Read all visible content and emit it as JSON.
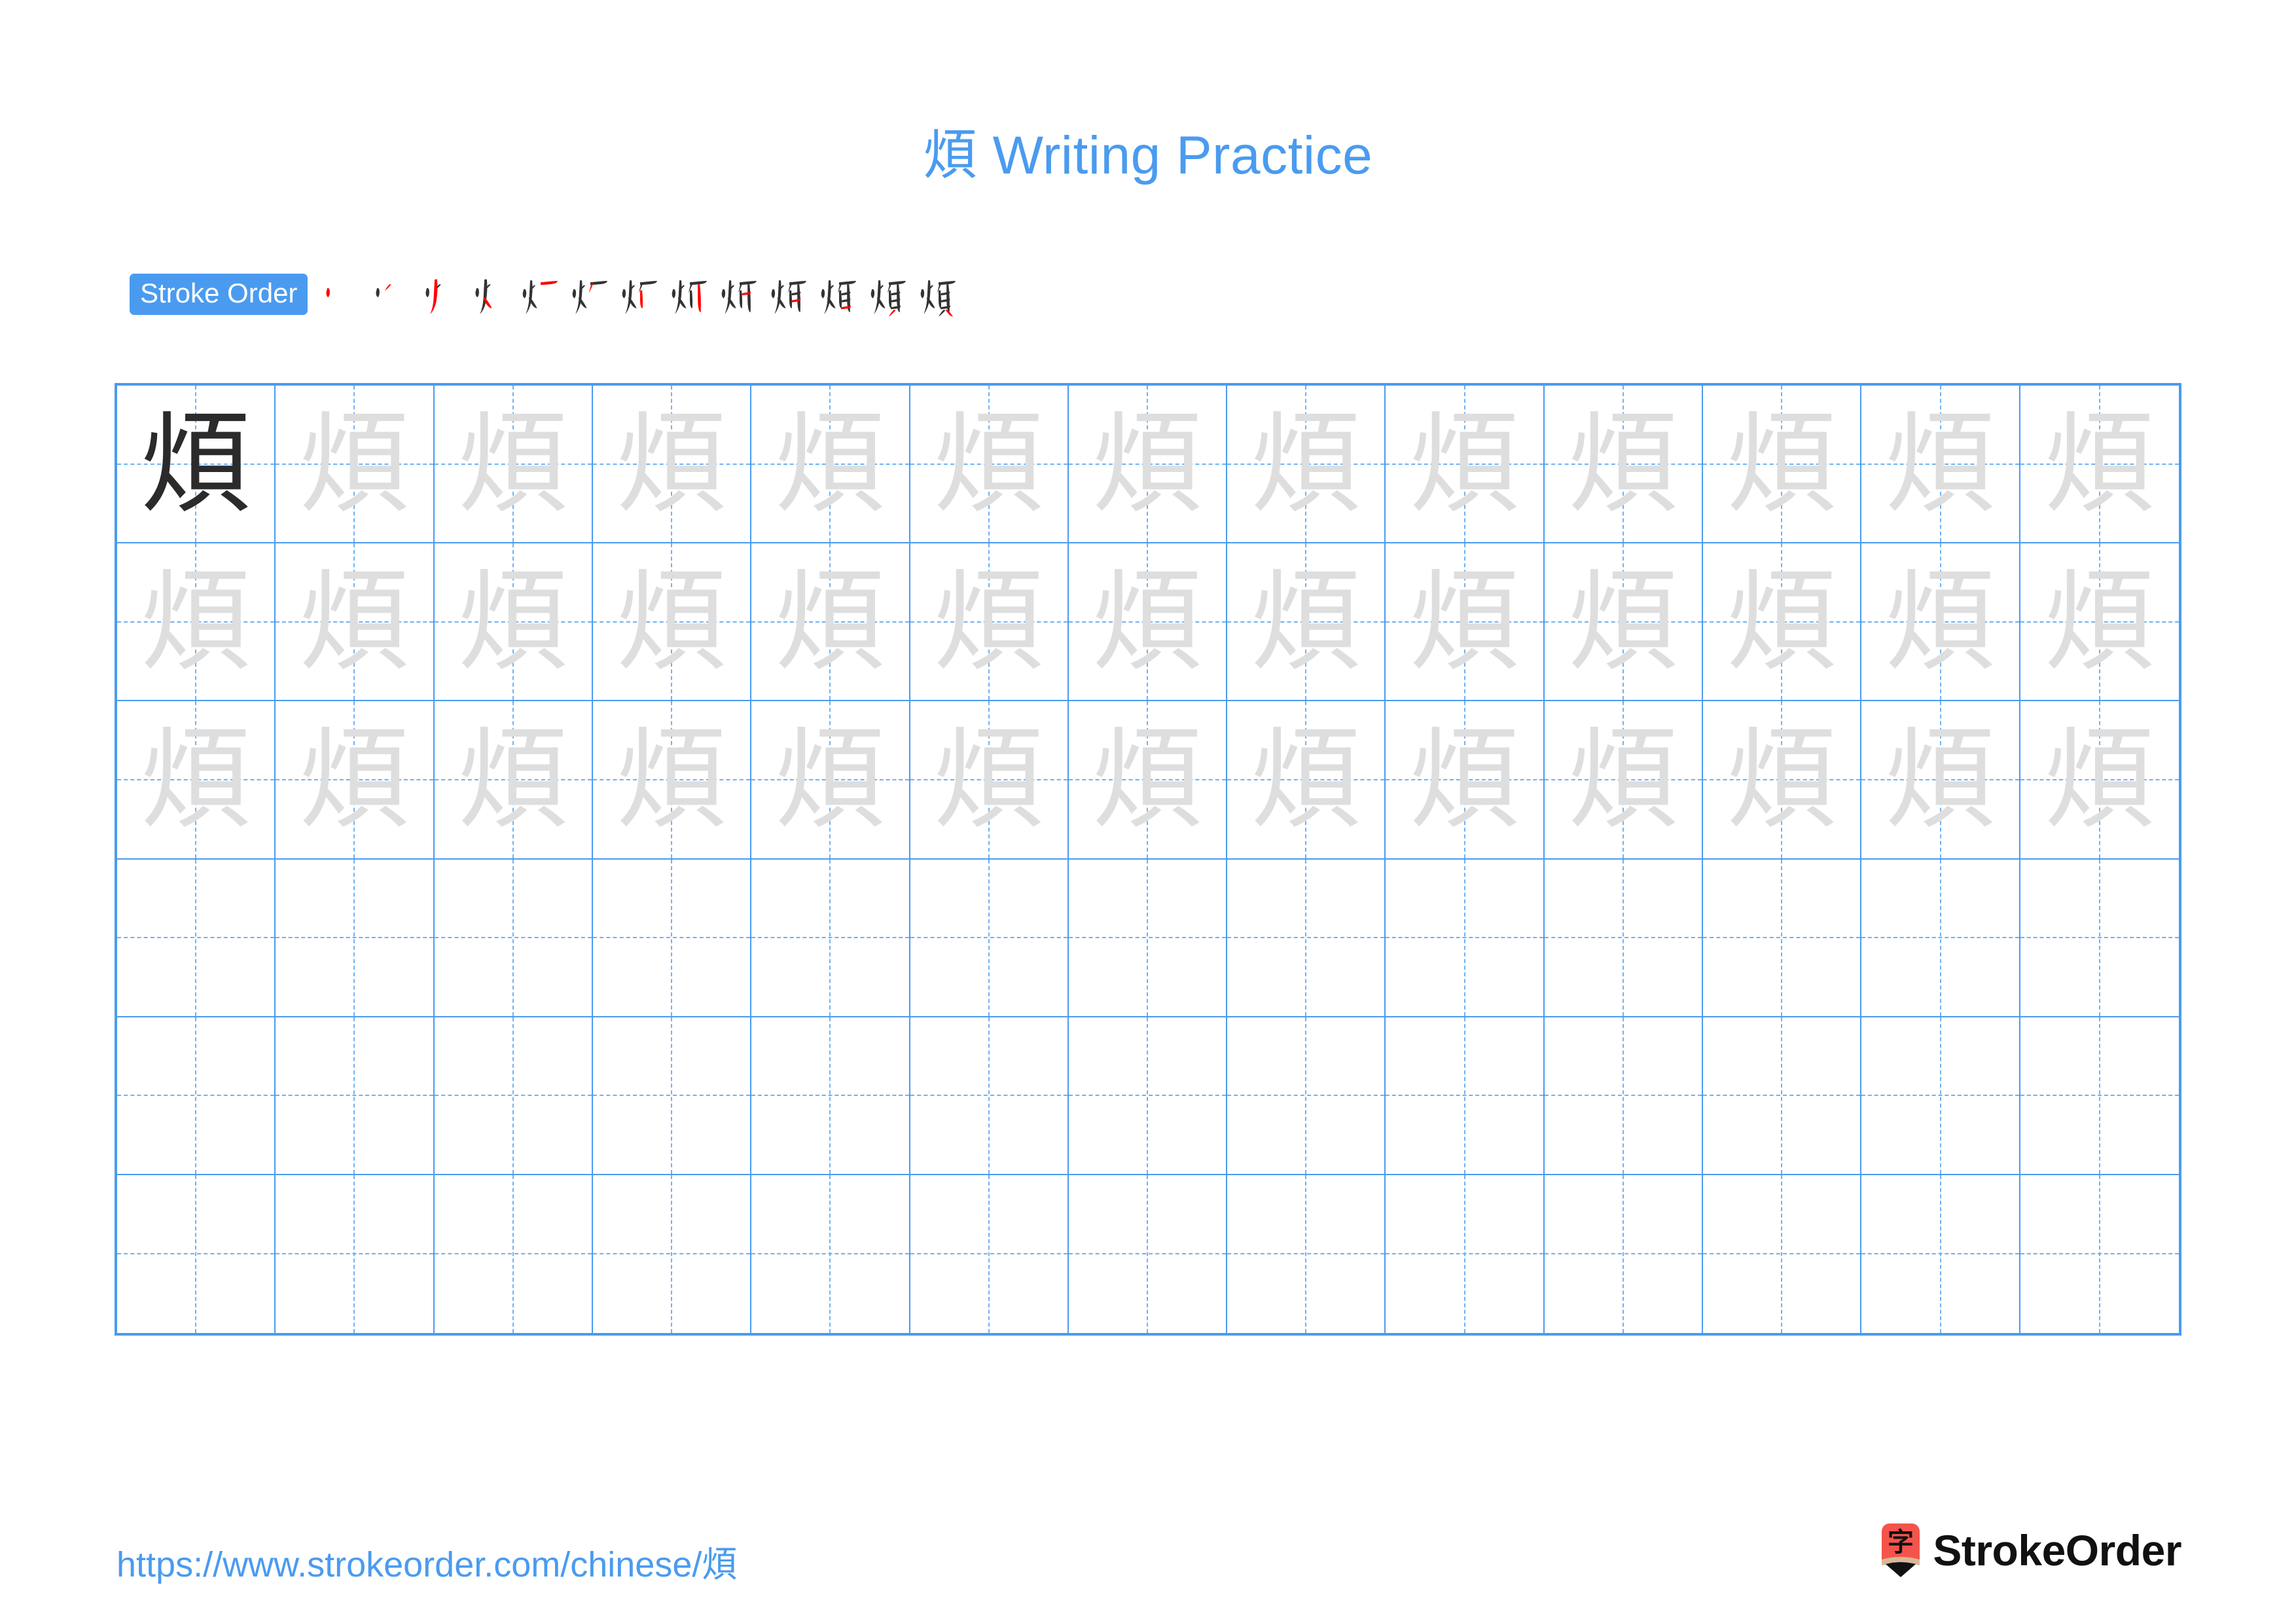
{
  "character": "煩",
  "colors": {
    "accent_blue": "#4a9bf0",
    "grid_line_blue": "#4a9bf0",
    "grid_dash_blue": "#6fb2f4",
    "solid_char": "#2b2b2b",
    "trace_char": "#dedede",
    "stroke_new": "#ff0000",
    "stroke_old": "#333333",
    "logo_red": "#f4544c",
    "logo_tan": "#d9b89a",
    "brand_black": "#111111"
  },
  "header": {
    "title": "煩 Writing Practice",
    "title_character": "煩",
    "title_suffix": "Writing Practice"
  },
  "stroke_order": {
    "label": "Stroke Order",
    "total_strokes": 13,
    "steps": [
      1,
      2,
      3,
      4,
      5,
      6,
      7,
      8,
      9,
      10,
      11,
      12,
      13
    ]
  },
  "practice_grid": {
    "columns": 13,
    "rows": 6,
    "model_character": "煩",
    "rows_data": [
      {
        "index": 0,
        "cells": [
          {
            "char": "煩",
            "style": "solid"
          },
          {
            "char": "煩",
            "style": "trace"
          },
          {
            "char": "煩",
            "style": "trace"
          },
          {
            "char": "煩",
            "style": "trace"
          },
          {
            "char": "煩",
            "style": "trace"
          },
          {
            "char": "煩",
            "style": "trace"
          },
          {
            "char": "煩",
            "style": "trace"
          },
          {
            "char": "煩",
            "style": "trace"
          },
          {
            "char": "煩",
            "style": "trace"
          },
          {
            "char": "煩",
            "style": "trace"
          },
          {
            "char": "煩",
            "style": "trace"
          },
          {
            "char": "煩",
            "style": "trace"
          },
          {
            "char": "煩",
            "style": "trace"
          }
        ]
      },
      {
        "index": 1,
        "cells": [
          {
            "char": "煩",
            "style": "trace"
          },
          {
            "char": "煩",
            "style": "trace"
          },
          {
            "char": "煩",
            "style": "trace"
          },
          {
            "char": "煩",
            "style": "trace"
          },
          {
            "char": "煩",
            "style": "trace"
          },
          {
            "char": "煩",
            "style": "trace"
          },
          {
            "char": "煩",
            "style": "trace"
          },
          {
            "char": "煩",
            "style": "trace"
          },
          {
            "char": "煩",
            "style": "trace"
          },
          {
            "char": "煩",
            "style": "trace"
          },
          {
            "char": "煩",
            "style": "trace"
          },
          {
            "char": "煩",
            "style": "trace"
          },
          {
            "char": "煩",
            "style": "trace"
          }
        ]
      },
      {
        "index": 2,
        "cells": [
          {
            "char": "煩",
            "style": "trace"
          },
          {
            "char": "煩",
            "style": "trace"
          },
          {
            "char": "煩",
            "style": "trace"
          },
          {
            "char": "煩",
            "style": "trace"
          },
          {
            "char": "煩",
            "style": "trace"
          },
          {
            "char": "煩",
            "style": "trace"
          },
          {
            "char": "煩",
            "style": "trace"
          },
          {
            "char": "煩",
            "style": "trace"
          },
          {
            "char": "煩",
            "style": "trace"
          },
          {
            "char": "煩",
            "style": "trace"
          },
          {
            "char": "煩",
            "style": "trace"
          },
          {
            "char": "煩",
            "style": "trace"
          },
          {
            "char": "煩",
            "style": "trace"
          }
        ]
      },
      {
        "index": 3,
        "cells": [
          {
            "char": "",
            "style": "empty"
          },
          {
            "char": "",
            "style": "empty"
          },
          {
            "char": "",
            "style": "empty"
          },
          {
            "char": "",
            "style": "empty"
          },
          {
            "char": "",
            "style": "empty"
          },
          {
            "char": "",
            "style": "empty"
          },
          {
            "char": "",
            "style": "empty"
          },
          {
            "char": "",
            "style": "empty"
          },
          {
            "char": "",
            "style": "empty"
          },
          {
            "char": "",
            "style": "empty"
          },
          {
            "char": "",
            "style": "empty"
          },
          {
            "char": "",
            "style": "empty"
          },
          {
            "char": "",
            "style": "empty"
          }
        ]
      },
      {
        "index": 4,
        "cells": [
          {
            "char": "",
            "style": "empty"
          },
          {
            "char": "",
            "style": "empty"
          },
          {
            "char": "",
            "style": "empty"
          },
          {
            "char": "",
            "style": "empty"
          },
          {
            "char": "",
            "style": "empty"
          },
          {
            "char": "",
            "style": "empty"
          },
          {
            "char": "",
            "style": "empty"
          },
          {
            "char": "",
            "style": "empty"
          },
          {
            "char": "",
            "style": "empty"
          },
          {
            "char": "",
            "style": "empty"
          },
          {
            "char": "",
            "style": "empty"
          },
          {
            "char": "",
            "style": "empty"
          },
          {
            "char": "",
            "style": "empty"
          }
        ]
      },
      {
        "index": 5,
        "cells": [
          {
            "char": "",
            "style": "empty"
          },
          {
            "char": "",
            "style": "empty"
          },
          {
            "char": "",
            "style": "empty"
          },
          {
            "char": "",
            "style": "empty"
          },
          {
            "char": "",
            "style": "empty"
          },
          {
            "char": "",
            "style": "empty"
          },
          {
            "char": "",
            "style": "empty"
          },
          {
            "char": "",
            "style": "empty"
          },
          {
            "char": "",
            "style": "empty"
          },
          {
            "char": "",
            "style": "empty"
          },
          {
            "char": "",
            "style": "empty"
          },
          {
            "char": "",
            "style": "empty"
          },
          {
            "char": "",
            "style": "empty"
          }
        ]
      }
    ]
  },
  "footer": {
    "url": "https://www.strokeorder.com/chinese/煩",
    "brand_name": "StrokeOrder",
    "logo_character": "字"
  }
}
